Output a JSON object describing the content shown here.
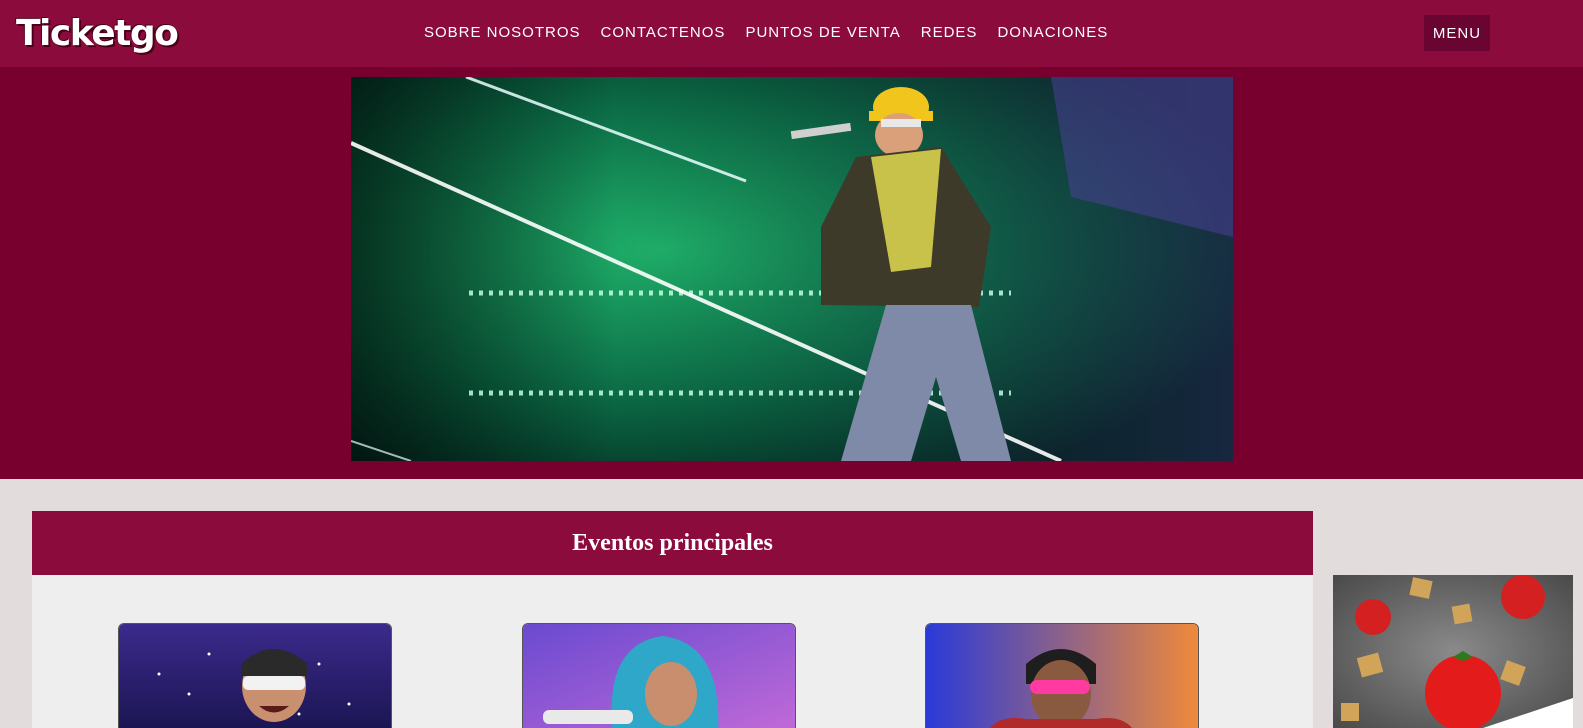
{
  "brand": {
    "logo_text": "Ticketgo"
  },
  "nav": {
    "items": [
      {
        "label": "SOBRE NOSOTROS"
      },
      {
        "label": "CONTACTENOS"
      },
      {
        "label": "PUNTOS DE VENTA"
      },
      {
        "label": "REDES"
      },
      {
        "label": "DONACIONES"
      }
    ],
    "menu_label": "MENU"
  },
  "main": {
    "title": "Eventos principales",
    "cards": [
      {
        "photo": "artist-photo-1"
      },
      {
        "photo": "artist-photo-2"
      },
      {
        "photo": "artist-photo-3"
      }
    ]
  },
  "colors": {
    "brand": "#8c0b3d",
    "hero_band": "#78002e",
    "page_bg": "#e3dcdc",
    "panel_bg": "#eeeeee"
  }
}
